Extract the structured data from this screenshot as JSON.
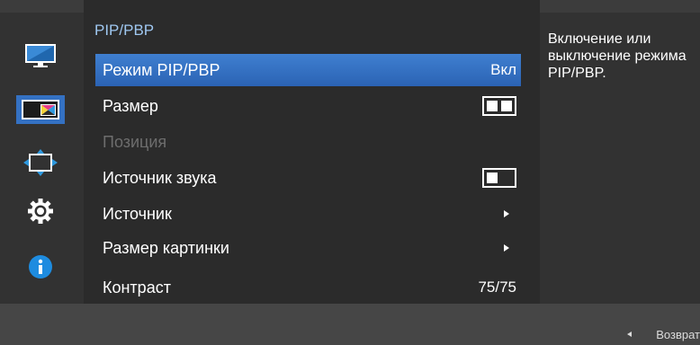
{
  "menu": {
    "title": "PIP/PBP",
    "rows": [
      {
        "label": "Режим PIP/PBP",
        "value": "Вкл"
      },
      {
        "label": "Размер"
      },
      {
        "label": "Позиция"
      },
      {
        "label": "Источник звука"
      },
      {
        "label": "Источник"
      },
      {
        "label": "Размер картинки"
      },
      {
        "label": "Контраст",
        "value": "75/75"
      }
    ]
  },
  "help": {
    "text": "Включение или выключение режима PIP/PBP."
  },
  "footer": {
    "return_label": "Возврат"
  },
  "sidebar": {
    "icons": [
      "monitor-icon",
      "picture-icon",
      "position-arrows-icon",
      "settings-gear-icon",
      "info-icon"
    ]
  },
  "colors": {
    "selected": "#3471c3",
    "title": "#9fc7f0",
    "disabled": "#6d6d6d",
    "info": "#1e8ce0"
  }
}
